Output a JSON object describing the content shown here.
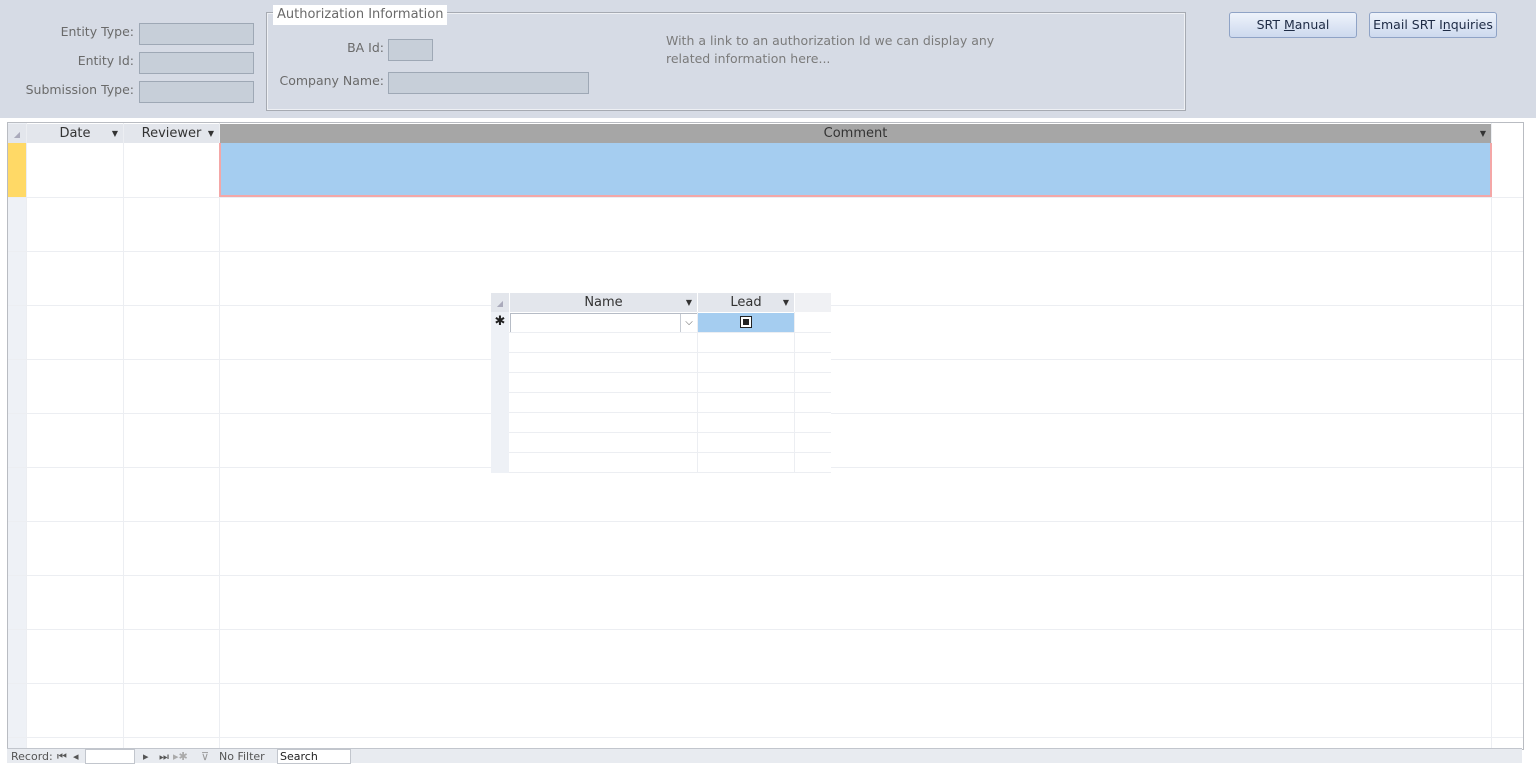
{
  "form": {
    "entity_type_label": "Entity Type:",
    "entity_id_label": "Entity Id:",
    "submission_type_label": "Submission Type:",
    "entity_type_value": "",
    "entity_id_value": "",
    "submission_type_value": ""
  },
  "auth": {
    "legend": "Authorization Information",
    "ba_id_label": "BA Id:",
    "company_name_label": "Company Name:",
    "ba_id_value": "",
    "company_name_value": "",
    "info_line1": "With a link to an authorization Id we can display any",
    "info_line2": "related information here..."
  },
  "buttons": {
    "manual_prefix": "SRT ",
    "manual_hotkey": "M",
    "manual_suffix": "anual",
    "email_prefix": "Email SRT I",
    "email_hotkey": "n",
    "email_suffix": "quiries"
  },
  "sheet": {
    "columns": [
      "Date",
      "Reviewer",
      "Comment"
    ]
  },
  "subform": {
    "columns": [
      "Name",
      "Lead"
    ],
    "new_row_marker": "✱",
    "name_value": "",
    "lead_checked": true
  },
  "navbar": {
    "record_label": "Record:",
    "first": "⏮",
    "prev": "◂",
    "next": "▸",
    "last": "⏭",
    "new": "▸✱",
    "filter_icon": "⊽",
    "filter_text": "No Filter",
    "search_text": "Search",
    "record_value": ""
  },
  "colors": {
    "header_bg": "#d6dbe5",
    "selected_row": "#a5cdf0",
    "current_record": "#ffd966",
    "focus_border": "#f4a7a7"
  }
}
